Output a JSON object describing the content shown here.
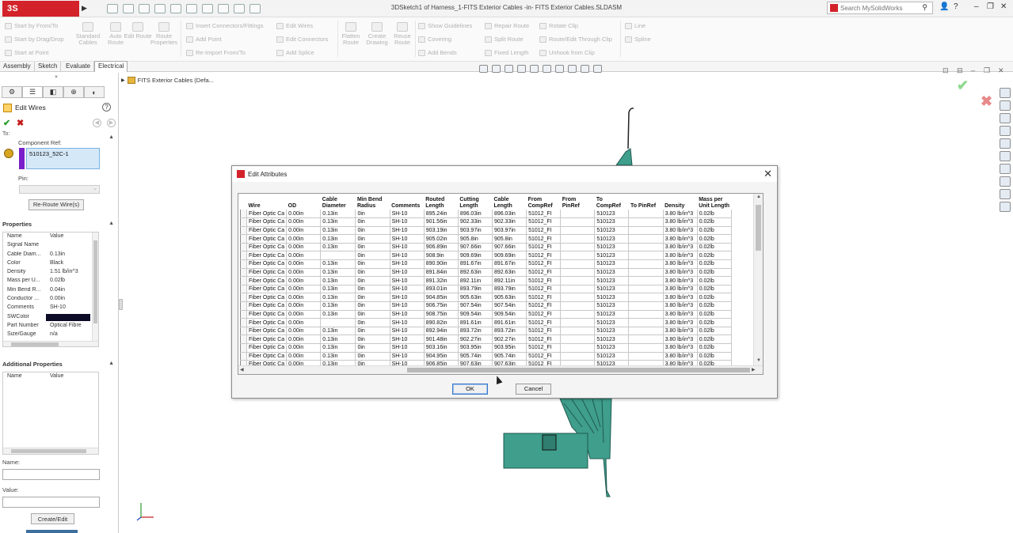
{
  "app": {
    "logo": "3S SOLIDWORKS",
    "window_title": "3DSketch1 of Harness_1-FITS Exterior Cables -in- FITS Exterior Cables.SLDASM",
    "search_placeholder": "Search MySolidWorks",
    "search_icon": "magnifier-icon"
  },
  "commands": {
    "start_from_to": "Start by From/To",
    "start_drag_drop": "Start by Drag/Drop",
    "start_at_point": "Start at Point",
    "standard_cables": "Standard Cables",
    "auto_route": "Auto Route",
    "edit_route": "Edit Route",
    "route_properties": "Route Properties",
    "insert_connectors": "Insert Connectors/Fittings",
    "add_point": "Add Point",
    "reimport": "Re-Import From/To",
    "edit_wires": "Edit Wires",
    "edit_connectors": "Edit Connectors",
    "add_splice": "Add Splice",
    "flatten_route": "Flatten Route",
    "create_drawing": "Create Drawing",
    "reuse_route": "Reuse Route",
    "show_guidelines": "Show Guidelines",
    "covering": "Covering",
    "add_bends": "Add Bends",
    "repair_route": "Repair Route",
    "split_route": "Split Route",
    "fixed_length": "Fixed Length",
    "rotate_clip": "Rotate Clip",
    "route_through_clip": "Route/Edit Through Clip",
    "unhook_clip": "Unhook from Clip",
    "line": "Line",
    "spline": "Spline"
  },
  "tabs": [
    "Assembly",
    "Sketch",
    "Evaluate",
    "Electrical"
  ],
  "active_tab": "Electrical",
  "tree": {
    "root": "FITS Exterior Cables  (Defa..."
  },
  "property_manager": {
    "title": "Edit Wires",
    "cut_label": "To:",
    "component_ref_label": "Component Ref:",
    "component_ref_value": "510123_52C-1",
    "pin_label": "Pin:",
    "reroute_button": "Re-Route Wire(s)",
    "properties_title": "Properties",
    "prop_header_name": "Name",
    "prop_header_value": "Value",
    "properties": [
      {
        "name": "Signal Name",
        "value": ""
      },
      {
        "name": "Cable Diam...",
        "value": "0.13in"
      },
      {
        "name": "Color",
        "value": "Black"
      },
      {
        "name": "Density",
        "value": "1.51 lb/in^3"
      },
      {
        "name": "Mass per U...",
        "value": "0.02lb"
      },
      {
        "name": "Min Bend R...",
        "value": "0.04in"
      },
      {
        "name": "Conductor ...",
        "value": "0.00in"
      },
      {
        "name": "Comments",
        "value": "SH-10"
      },
      {
        "name": "SWColor",
        "value": ""
      },
      {
        "name": "Part Number",
        "value": "Optical Fibre"
      },
      {
        "name": "Size/Gauge",
        "value": "n/a"
      }
    ],
    "swcolor_hex": "#0c0c26",
    "additional_title": "Additional Properties",
    "add_header_name": "Name",
    "add_header_value": "Value",
    "name_label": "Name:",
    "value_label": "Value:",
    "create_edit_button": "Create/Edit"
  },
  "dialog": {
    "title": "Edit Attributes",
    "ok": "OK",
    "cancel": "Cancel",
    "columns": [
      "Wire",
      "OD",
      "Cable Diameter",
      "Min Bend Radius",
      "Comments",
      "Routed Length",
      "Cutting Length",
      "Cable Length",
      "From CompRef",
      "From PinRef",
      "To CompRef",
      "To PinRef",
      "Density",
      "Mass per Unit Length"
    ],
    "rows": [
      [
        "Fiber Optic Ca",
        "0.00in",
        "0.13in",
        "0in",
        "SH-10",
        "895.24in",
        "896.03in",
        "896.03in",
        "51012_FI",
        "",
        "510123",
        "",
        "3.80 lb/in^3",
        "0.02lb"
      ],
      [
        "Fiber Optic Ca",
        "0.00in",
        "0.13in",
        "0in",
        "SH-10",
        "901.56in",
        "902.33in",
        "902.33in",
        "51012_FI",
        "",
        "510123",
        "",
        "3.80 lb/in^3",
        "0.02lb"
      ],
      [
        "Fiber Optic Ca",
        "0.00in",
        "0.13in",
        "0in",
        "SH-10",
        "903.19in",
        "903.97in",
        "903.97in",
        "51012_FI",
        "",
        "510123",
        "",
        "3.80 lb/in^3",
        "0.02lb"
      ],
      [
        "Fiber Optic Ca",
        "0.00in",
        "0.13in",
        "0in",
        "SH-10",
        "905.02in",
        "905.8in",
        "905.8in",
        "51012_FI",
        "",
        "510123",
        "",
        "3.80 lb/in^3",
        "0.02lb"
      ],
      [
        "Fiber Optic Ca",
        "0.00in",
        "0.13in",
        "0in",
        "SH-10",
        "906.89in",
        "907.66in",
        "907.66in",
        "51012_FI",
        "",
        "510123",
        "",
        "3.80 lb/in^3",
        "0.02lb"
      ],
      [
        "Fiber Optic Ca",
        "0.00in",
        "",
        "0in",
        "SH-10",
        "908.9in",
        "909.69in",
        "909.69in",
        "51012_FI",
        "",
        "510123",
        "",
        "3.80 lb/in^3",
        "0.02lb"
      ],
      [
        "Fiber Optic Ca",
        "0.00in",
        "0.13in",
        "0in",
        "SH-10",
        "890.90in",
        "891.67in",
        "891.67in",
        "51012_FI",
        "",
        "510123",
        "",
        "3.80 lb/in^3",
        "0.02lb"
      ],
      [
        "Fiber Optic Ca",
        "0.00in",
        "0.13in",
        "0in",
        "SH-10",
        "891.84in",
        "892.63in",
        "892.63in",
        "51012_FI",
        "",
        "510123",
        "",
        "3.80 lb/in^3",
        "0.02lb"
      ],
      [
        "Fiber Optic Ca",
        "0.00in",
        "0.13in",
        "0in",
        "SH-10",
        "891.32in",
        "892.11in",
        "892.11in",
        "51012_FI",
        "",
        "510123",
        "",
        "3.80 lb/in^3",
        "0.02lb"
      ],
      [
        "Fiber Optic Ca",
        "0.00in",
        "0.13in",
        "0in",
        "SH-10",
        "893.01in",
        "893.79in",
        "893.79in",
        "51012_FI",
        "",
        "510123",
        "",
        "3.80 lb/in^3",
        "0.02lb"
      ],
      [
        "Fiber Optic Ca",
        "0.00in",
        "0.13in",
        "0in",
        "SH-10",
        "904.85in",
        "905.63in",
        "905.63in",
        "51012_FI",
        "",
        "510123",
        "",
        "3.80 lb/in^3",
        "0.02lb"
      ],
      [
        "Fiber Optic Ca",
        "0.00in",
        "0.13in",
        "0in",
        "SH-10",
        "906.75in",
        "907.54in",
        "907.54in",
        "51012_FI",
        "",
        "510123",
        "",
        "3.80 lb/in^3",
        "0.02lb"
      ],
      [
        "Fiber Optic Ca",
        "0.00in",
        "0.13in",
        "0in",
        "SH-10",
        "908.75in",
        "909.54in",
        "909.54in",
        "51012_FI",
        "",
        "510123",
        "",
        "3.80 lb/in^3",
        "0.02lb"
      ],
      [
        "Fiber Optic Ca",
        "0.00in",
        "",
        "0in",
        "SH-10",
        "890.82in",
        "891.61in",
        "891.61in",
        "51012_FI",
        "",
        "510123",
        "",
        "3.80 lb/in^3",
        "0.02lb"
      ],
      [
        "Fiber Optic Ca",
        "0.00in",
        "0.13in",
        "0in",
        "SH-10",
        "892.94in",
        "893.72in",
        "893.72in",
        "51012_FI",
        "",
        "510123",
        "",
        "3.80 lb/in^3",
        "0.02lb"
      ],
      [
        "Fiber Optic Ca",
        "0.00in",
        "0.13in",
        "0in",
        "SH-10",
        "901.48in",
        "902.27in",
        "902.27in",
        "51012_FI",
        "",
        "510123",
        "",
        "3.80 lb/in^3",
        "0.02lb"
      ],
      [
        "Fiber Optic Ca",
        "0.00in",
        "0.13in",
        "0in",
        "SH-10",
        "903.16in",
        "903.95in",
        "903.95in",
        "51012_FI",
        "",
        "510123",
        "",
        "3.80 lb/in^3",
        "0.02lb"
      ],
      [
        "Fiber Optic Ca",
        "0.00in",
        "0.13in",
        "0in",
        "SH-10",
        "904.95in",
        "905.74in",
        "905.74in",
        "51012_FI",
        "",
        "510123",
        "",
        "3.80 lb/in^3",
        "0.02lb"
      ],
      [
        "Fiber Optic Ca",
        "0.00in",
        "0.13in",
        "0in",
        "SH-10",
        "906.85in",
        "907.63in",
        "907.63in",
        "51012_FI",
        "",
        "510123",
        "",
        "3.80 lb/in^3",
        "0.02lb"
      ]
    ]
  },
  "colors": {
    "brand": "#d3222a",
    "model_teal": "#3f9e8c",
    "accent_blue": "#3a76c8"
  }
}
